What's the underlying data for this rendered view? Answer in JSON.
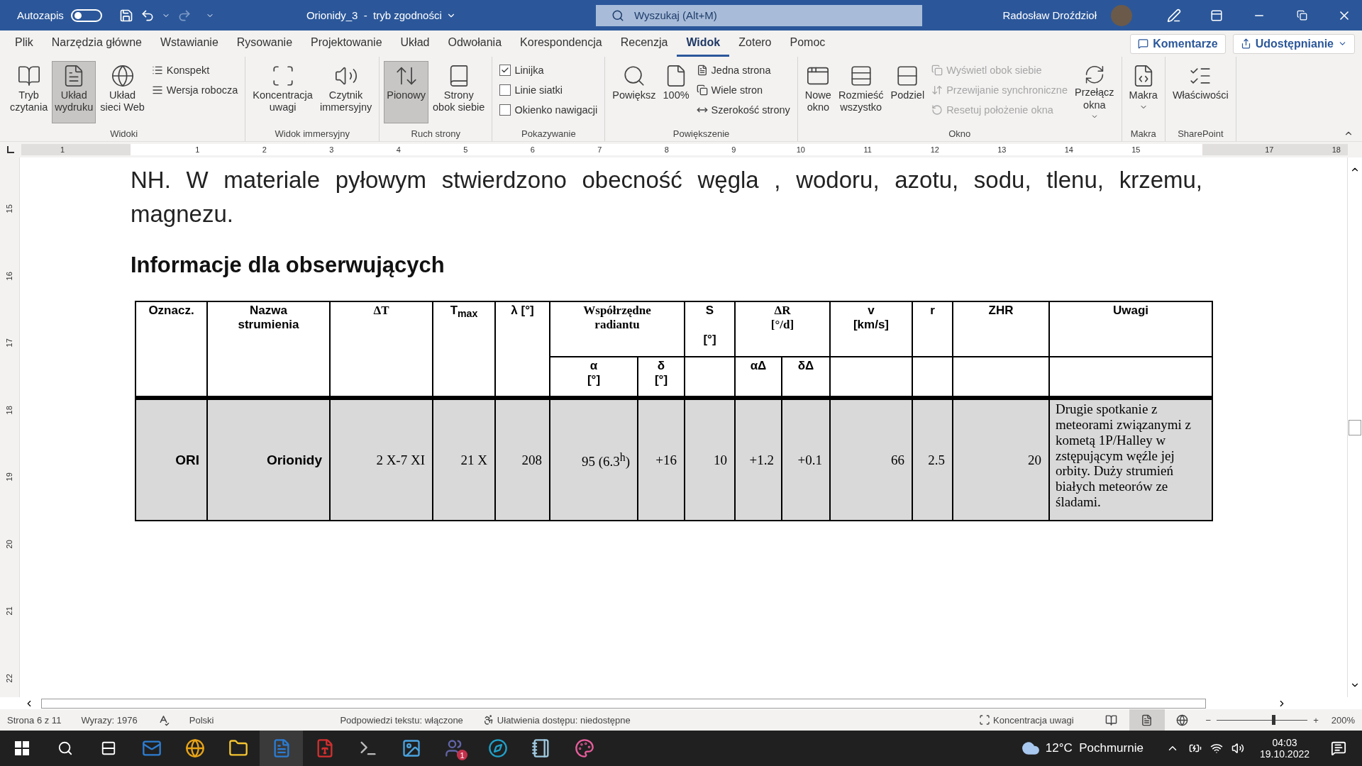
{
  "title_bar": {
    "autosave_label": "Autozapis",
    "autosave_on": false,
    "document_title": "Orionidy_3  -  tryb zgodności",
    "search_placeholder": "Wyszukaj (Alt+M)",
    "user_name": "Radosław Droździoł"
  },
  "menu_tabs": [
    {
      "label": "Plik",
      "selected": false
    },
    {
      "label": "Narzędzia główne",
      "selected": false
    },
    {
      "label": "Wstawianie",
      "selected": false
    },
    {
      "label": "Rysowanie",
      "selected": false
    },
    {
      "label": "Projektowanie",
      "selected": false
    },
    {
      "label": "Układ",
      "selected": false
    },
    {
      "label": "Odwołania",
      "selected": false
    },
    {
      "label": "Korespondencja",
      "selected": false
    },
    {
      "label": "Recenzja",
      "selected": false
    },
    {
      "label": "Widok",
      "selected": true
    },
    {
      "label": "Zotero",
      "selected": false
    },
    {
      "label": "Pomoc",
      "selected": false
    }
  ],
  "comments_button": "Komentarze",
  "share_button": "Udostępnianie",
  "ribbon": {
    "groups": [
      {
        "label": "Widoki",
        "items": [
          {
            "kind": "large",
            "label": "Tryb\nczytania",
            "selected": false
          },
          {
            "kind": "large",
            "label": "Układ\nwydruku",
            "selected": true
          },
          {
            "kind": "large",
            "label": "Układ\nsieci Web",
            "selected": false
          },
          {
            "kind": "stack",
            "items": [
              {
                "kind": "small",
                "label": "Konspekt",
                "disabled": false
              },
              {
                "kind": "small",
                "label": "Wersja robocza",
                "disabled": false
              }
            ]
          }
        ]
      },
      {
        "label": "Widok immersyjny",
        "items": [
          {
            "kind": "large",
            "label": "Koncentracja\nuwagi"
          },
          {
            "kind": "large",
            "label": "Czytnik\nimmersyjny"
          }
        ]
      },
      {
        "label": "Ruch strony",
        "items": [
          {
            "kind": "large",
            "label": "Pionowy",
            "selected": true
          },
          {
            "kind": "large",
            "label": "Strony\nobok siebie",
            "selected": false
          }
        ]
      },
      {
        "label": "Pokazywanie",
        "items": [
          {
            "kind": "stack",
            "items": [
              {
                "kind": "check",
                "label": "Linijka",
                "checked": true
              },
              {
                "kind": "check",
                "label": "Linie siatki",
                "checked": false
              },
              {
                "kind": "check",
                "label": "Okienko nawigacji",
                "checked": false
              }
            ]
          }
        ]
      },
      {
        "label": "Powiększenie",
        "items": [
          {
            "kind": "large",
            "label": "Powiększ"
          },
          {
            "kind": "large",
            "label": "100%"
          },
          {
            "kind": "stack",
            "items": [
              {
                "kind": "small",
                "label": "Jedna strona",
                "disabled": false
              },
              {
                "kind": "small",
                "label": "Wiele stron",
                "disabled": false
              },
              {
                "kind": "small",
                "label": "Szerokość strony",
                "disabled": false
              }
            ]
          }
        ]
      },
      {
        "label": "Okno",
        "items": [
          {
            "kind": "large",
            "label": "Nowe\nokno"
          },
          {
            "kind": "large",
            "label": "Rozmieść\nwszystko"
          },
          {
            "kind": "large",
            "label": "Podziel"
          },
          {
            "kind": "stack",
            "items": [
              {
                "kind": "small",
                "label": "Wyświetl obok siebie",
                "disabled": true
              },
              {
                "kind": "small",
                "label": "Przewijanie synchroniczne",
                "disabled": true
              },
              {
                "kind": "small",
                "label": "Resetuj położenie okna",
                "disabled": true
              }
            ]
          },
          {
            "kind": "large",
            "label": "Przełącz\nokna",
            "dropdown": true
          }
        ]
      },
      {
        "label": "Makra",
        "items": [
          {
            "kind": "large",
            "label": "Makra",
            "dropdown": true
          }
        ]
      },
      {
        "label": "SharePoint",
        "items": [
          {
            "kind": "large",
            "label": "Właściwości"
          }
        ]
      }
    ]
  },
  "ruler": {
    "left_numbers": [
      "1"
    ],
    "numbers": [
      "1",
      "2",
      "3",
      "4",
      "5",
      "6",
      "7",
      "8",
      "9",
      "10",
      "11",
      "12",
      "13",
      "14",
      "15"
    ],
    "right_numbers": [
      "17",
      "18"
    ],
    "side_numbers": [
      "15",
      "16",
      "17",
      "18",
      "19",
      "20",
      "21",
      "22"
    ]
  },
  "document": {
    "paragraph": "NH. W materiale pyłowym stwierdzono obecność węgla , wodoru, azotu, sodu, tlenu, krzemu, magnezu.",
    "heading": "Informacje dla obserwujących",
    "table": {
      "header": [
        {
          "text": "Oznacz.",
          "rowspan": 2
        },
        {
          "text": "Nazwa\nstrumienia",
          "rowspan": 2
        },
        {
          "text": "ΔT",
          "rowspan": 2
        },
        {
          "text": "T$_{max}$",
          "rowspan": 2
        },
        {
          "text": "λ [°]",
          "rowspan": 2
        },
        {
          "text": "Współrzędne\nradiantu",
          "children": [
            {
              "text": "α\n[°]"
            },
            {
              "text": "δ\n[°]"
            }
          ]
        },
        {
          "text": "S\n\n[°]"
        },
        {
          "text": "ΔR\n[°/d]",
          "children": [
            {
              "text": "αΔ"
            },
            {
              "text": "δΔ"
            }
          ]
        },
        {
          "text": "v\n[km/s]"
        },
        {
          "text": "r"
        },
        {
          "text": "ZHR"
        },
        {
          "text": "Uwagi"
        }
      ],
      "rows": [
        [
          "ORI",
          "Orionidy",
          "2 X-7 XI",
          "21 X",
          "208",
          "95 (6.3$^{h}$)",
          "+16",
          "10",
          "+1.2",
          "+0.1",
          "66",
          "2.5",
          "20",
          "Drugie spotkanie z meteorami związanymi z kometą 1P/Halley w zstępującym węźle jej orbity. Duży strumień białych meteorów ze śladami."
        ]
      ]
    }
  },
  "status_bar": {
    "page": "Strona 6 z 11",
    "words": "Wyrazy: 1976",
    "language": "Polski",
    "predictions": "Podpowiedzi tekstu: włączone",
    "accessibility": "Ułatwienia dostępu: niedostępne",
    "focus": "Koncentracja uwagi",
    "views": [
      {
        "selected": false
      },
      {
        "selected": true
      },
      {
        "selected": false
      }
    ],
    "zoom": {
      "level": 0.62,
      "minus": "−",
      "plus": "+",
      "reading": "200%"
    }
  },
  "taskbar": {
    "apps": [
      {
        "selected": false
      },
      {
        "selected": false
      },
      {
        "selected": false
      },
      {
        "selected": true
      },
      {
        "selected": false
      },
      {
        "selected": false
      },
      {
        "selected": false
      },
      {
        "selected": false,
        "badge": "1"
      },
      {
        "selected": false
      },
      {
        "selected": false
      },
      {
        "selected": false
      }
    ],
    "weather": "12°C  Pochmurnie",
    "time": "04:03",
    "date": "19.10.2022"
  }
}
